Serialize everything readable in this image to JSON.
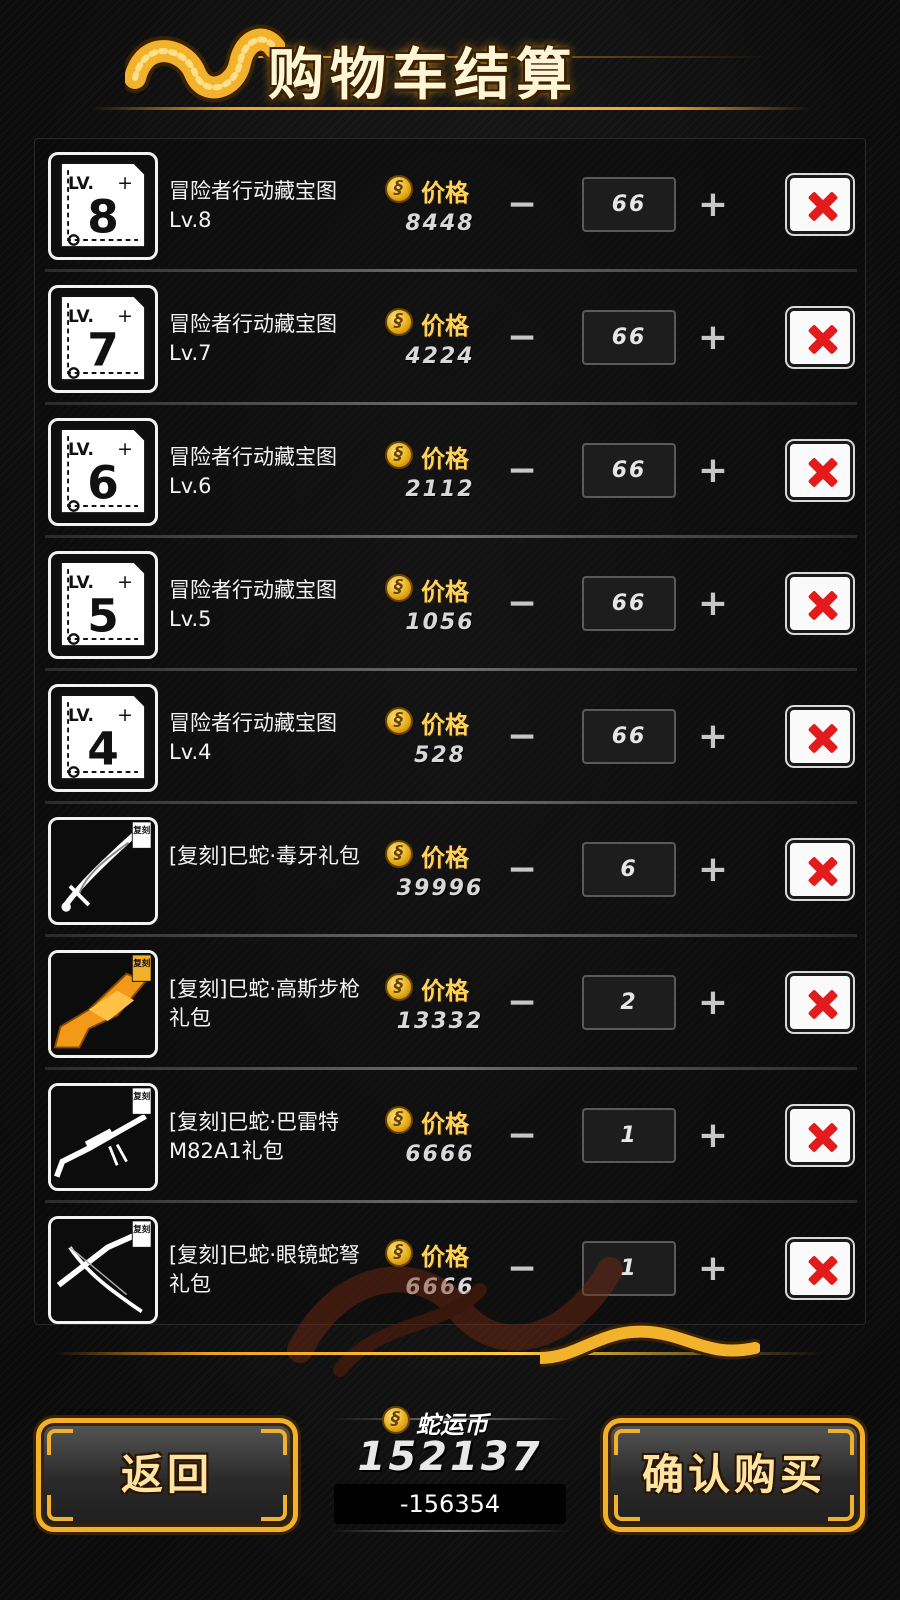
{
  "header": {
    "title": "购物车结算"
  },
  "columns": {
    "price_label": "价格"
  },
  "items": [
    {
      "name": "冒险者行动藏宝图Lv.8",
      "level": "8",
      "price": "8448",
      "qty": "66",
      "thumb": "treasure-map"
    },
    {
      "name": "冒险者行动藏宝图Lv.7",
      "level": "7",
      "price": "4224",
      "qty": "66",
      "thumb": "treasure-map"
    },
    {
      "name": "冒险者行动藏宝图Lv.6",
      "level": "6",
      "price": "2112",
      "qty": "66",
      "thumb": "treasure-map"
    },
    {
      "name": "冒险者行动藏宝图Lv.5",
      "level": "5",
      "price": "1056",
      "qty": "66",
      "thumb": "treasure-map"
    },
    {
      "name": "冒险者行动藏宝图Lv.4",
      "level": "4",
      "price": "528",
      "qty": "66",
      "thumb": "treasure-map"
    },
    {
      "name": "[复刻]巳蛇·毒牙礼包",
      "badge": "复刻",
      "price": "39996",
      "qty": "6",
      "thumb": "dagger"
    },
    {
      "name": "[复刻]巳蛇·高斯步枪礼包",
      "badge": "复刻",
      "price": "13332",
      "qty": "2",
      "thumb": "gauss-rifle"
    },
    {
      "name": "[复刻]巳蛇·巴雷特M82A1礼包",
      "badge": "复刻",
      "price": "6666",
      "qty": "1",
      "thumb": "sniper-rifle"
    },
    {
      "name": "[复刻]巳蛇·眼镜蛇弩礼包",
      "badge": "复刻",
      "price": "6666",
      "qty": "1",
      "thumb": "crossbow"
    }
  ],
  "map_label": "LV.",
  "controls": {
    "minus": "−",
    "plus": "+"
  },
  "footer": {
    "back_label": "返回",
    "confirm_label": "确认购买",
    "currency_label": "蛇运币",
    "balance": "152137",
    "remaining": "-156354"
  },
  "colors": {
    "accent": "#f1b12a",
    "delete": "#e21c1c",
    "price_label": "#ffd25a"
  }
}
